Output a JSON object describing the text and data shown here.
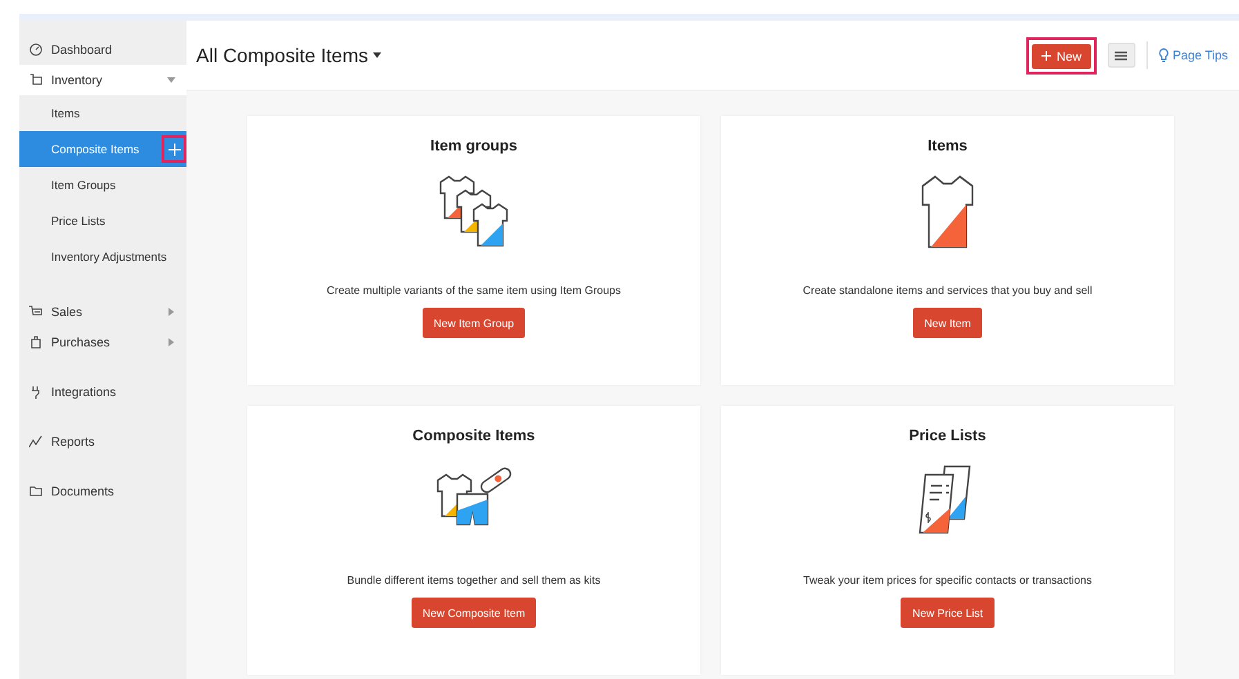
{
  "sidebar": {
    "items": [
      {
        "label": "Dashboard",
        "kind": "dashboard"
      },
      {
        "label": "Inventory",
        "kind": "inventory",
        "expanded": true,
        "children": [
          {
            "label": "Items",
            "selected": false
          },
          {
            "label": "Composite Items",
            "selected": true,
            "highlighted": true
          },
          {
            "label": "Item Groups",
            "selected": false
          },
          {
            "label": "Price Lists",
            "selected": false
          },
          {
            "label": "Inventory Adjustments",
            "selected": false
          }
        ]
      },
      {
        "label": "Sales",
        "kind": "sales",
        "expanded": false
      },
      {
        "label": "Purchases",
        "kind": "purchases",
        "expanded": false
      },
      {
        "label": "Integrations",
        "kind": "integrations"
      },
      {
        "label": "Reports",
        "kind": "reports"
      },
      {
        "label": "Documents",
        "kind": "documents"
      }
    ]
  },
  "header": {
    "title": "All Composite Items",
    "new_button": {
      "label": "New",
      "highlighted": true
    },
    "page_tips": "Page Tips"
  },
  "cards": [
    {
      "kind": "groups",
      "title": "Item groups",
      "description": "Create multiple variants of the same item using Item Groups",
      "button": "New Item Group"
    },
    {
      "kind": "item",
      "title": "Items",
      "description": "Create standalone items and services that you buy and sell",
      "button": "New Item"
    },
    {
      "kind": "composite",
      "title": "Composite Items",
      "description": "Bundle different items together and sell them as kits",
      "button": "New Composite Item"
    },
    {
      "kind": "pricelist",
      "title": "Price Lists",
      "description": "Tweak your item prices for specific contacts or transactions",
      "button": "New Price List"
    }
  ]
}
